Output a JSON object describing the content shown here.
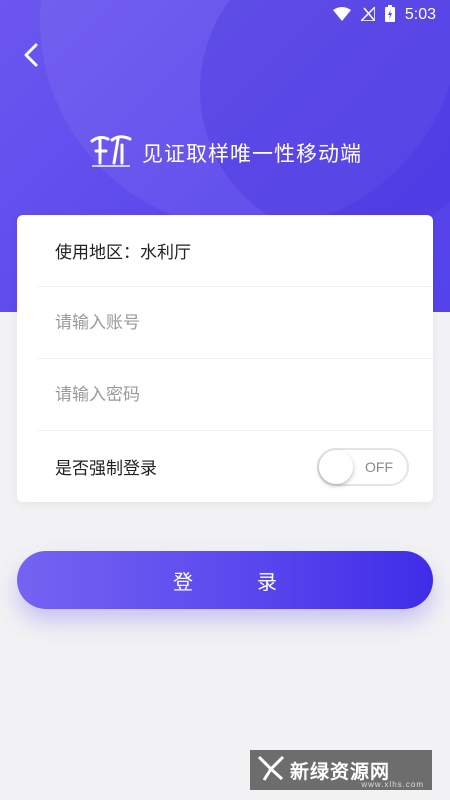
{
  "status_bar": {
    "time": "5:03"
  },
  "header": {
    "app_title": "见证取样唯一性移动端"
  },
  "form": {
    "region_label": "使用地区：水利厅",
    "account_placeholder": "请输入账号",
    "password_placeholder": "请输入密码",
    "force_login_label": "是否强制登录",
    "force_login_state": "OFF"
  },
  "login_button": {
    "label": "登录"
  },
  "watermark": {
    "text": "新绿资源网",
    "url": "www.xlhs.com"
  },
  "colors": {
    "primary": "#5b48ec",
    "background": "#f2f2f4"
  }
}
